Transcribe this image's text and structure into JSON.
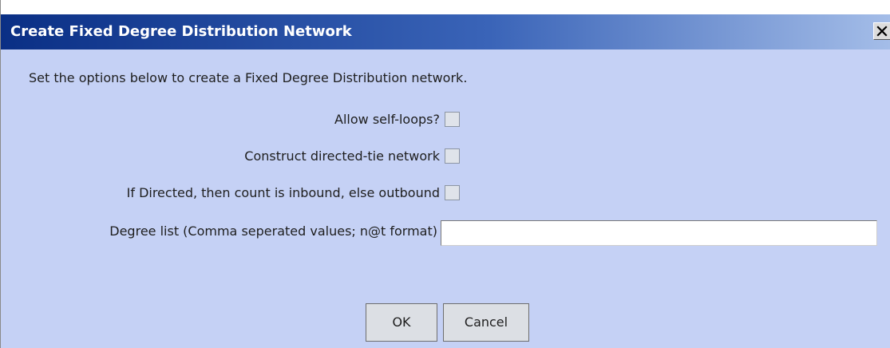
{
  "dialog": {
    "title": "Create Fixed Degree Distribution Network",
    "close_icon": "close-icon",
    "instructions": "Set the options below to create a Fixed Degree Distribution network."
  },
  "options": {
    "allow_self_loops": {
      "label": "Allow self-loops?",
      "checked": false
    },
    "directed_tie": {
      "label": "Construct directed-tie network",
      "checked": false
    },
    "inbound": {
      "label": "If Directed, then count is inbound, else outbound",
      "checked": false
    }
  },
  "degree_list": {
    "label": "Degree list (Comma seperated values; n@t format)",
    "value": "",
    "placeholder": ""
  },
  "buttons": {
    "ok": "OK",
    "cancel": "Cancel"
  },
  "colors": {
    "title_gradient_start": "#0a2f85",
    "title_gradient_end": "#a4bde8",
    "dialog_background": "#c5d1f5"
  }
}
